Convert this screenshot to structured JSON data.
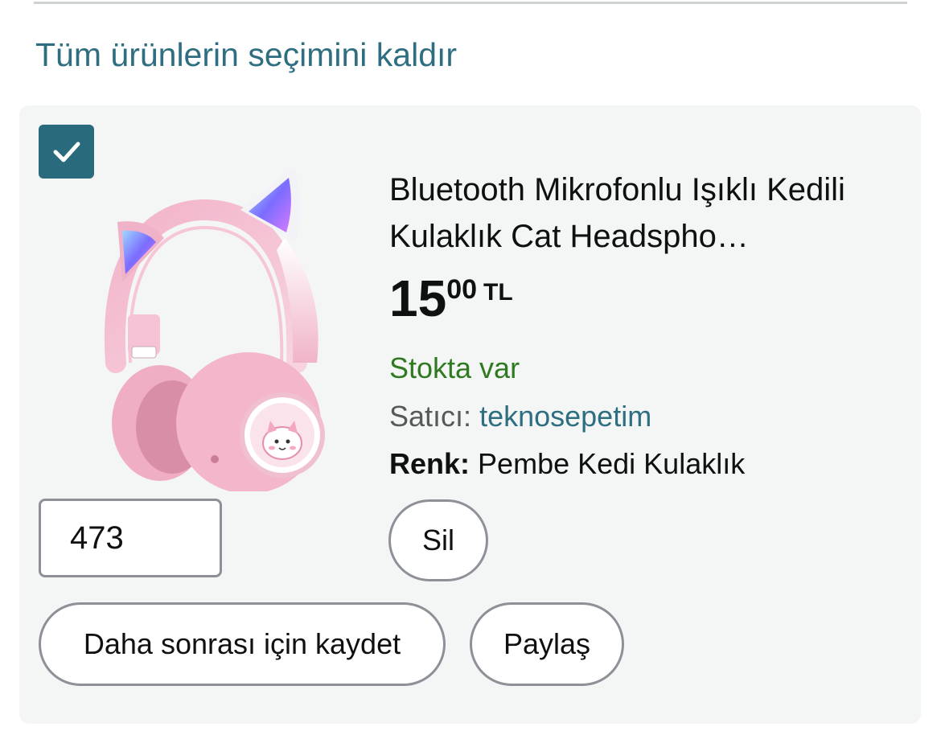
{
  "header": {
    "deselect_all_label": "Tüm ürünlerin seçimini kaldır"
  },
  "cart_item": {
    "checked": true,
    "title": "Bluetooth Mikrofonlu Işıklı Kedili Kulaklık Cat Headspho…",
    "price": {
      "whole": "15",
      "fraction": "00",
      "currency": "TL"
    },
    "stock_status": "Stokta var",
    "seller_label": "Satıcı:",
    "seller_name": "teknosepetim",
    "color_label": "Renk:",
    "color_value": "Pembe Kedi Kulaklık",
    "quantity": "473",
    "delete_label": "Sil",
    "save_for_later_label": "Daha sonrası için kaydet",
    "share_label": "Paylaş"
  },
  "colors": {
    "link": "#2e6e80",
    "in_stock": "#2f7a21",
    "checkbox_fill": "#2a6a7d",
    "card_background": "#f4f6f6"
  },
  "icons": {
    "checkbox": "checkmark-icon"
  }
}
